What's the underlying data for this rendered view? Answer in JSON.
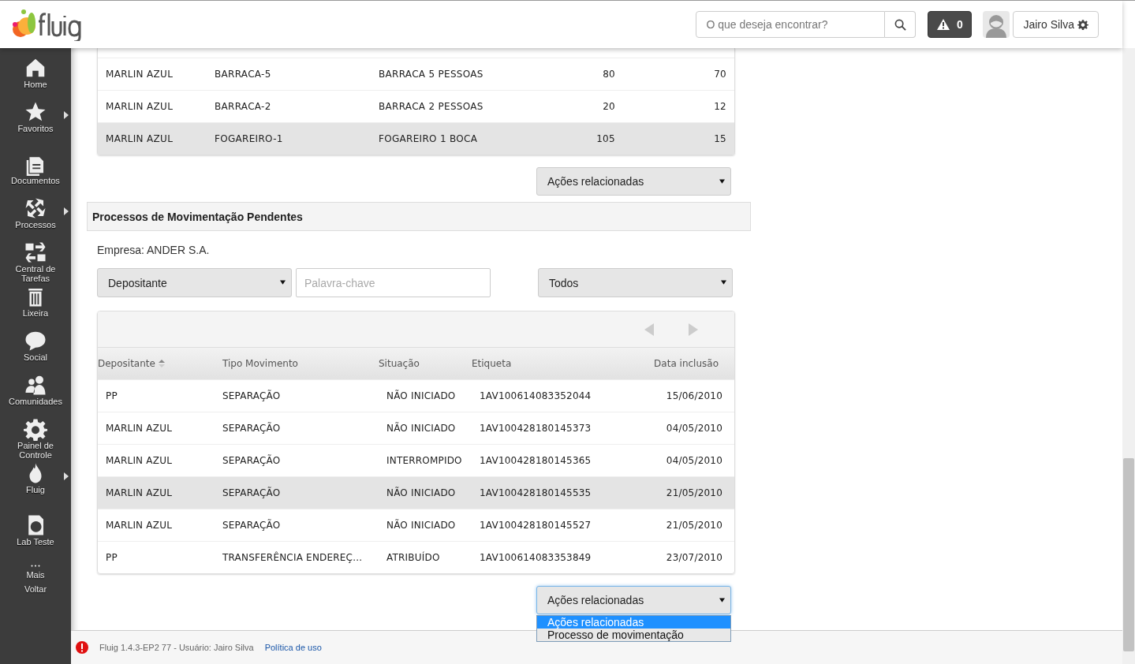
{
  "header": {
    "search": {
      "placeholder": "O que deseja encontrar?"
    },
    "alerts": {
      "count": "0"
    },
    "user": {
      "name": "Jairo Silva"
    }
  },
  "sidebar": {
    "items": [
      {
        "label": "Home",
        "has_submenu": false
      },
      {
        "label": "Favoritos",
        "has_submenu": true
      },
      {
        "label": "Documentos",
        "has_submenu": false
      },
      {
        "label": "Processos",
        "has_submenu": true
      },
      {
        "label": "Central de Tarefas",
        "has_submenu": false
      },
      {
        "label": "Lixeira",
        "has_submenu": false
      },
      {
        "label": "Social",
        "has_submenu": false
      },
      {
        "label": "Comunidades",
        "has_submenu": false
      },
      {
        "label": "Painel de Controle",
        "has_submenu": false
      },
      {
        "label": "Fluig",
        "has_submenu": true
      },
      {
        "label": "Lab Teste",
        "has_submenu": false
      },
      {
        "label": "Mais",
        "has_submenu": false
      },
      {
        "label": "Voltar",
        "has_submenu": false
      }
    ]
  },
  "stock_table": {
    "rows": [
      {
        "cells": [
          "MARLIN AZUL",
          "BARRACA-5",
          "BARRACA 5 PESSOAS",
          "80",
          "70"
        ],
        "highlighted": false
      },
      {
        "cells": [
          "MARLIN AZUL",
          "BARRACA-2",
          "BARRACA 2 PESSOAS",
          "20",
          "12"
        ],
        "highlighted": false
      },
      {
        "cells": [
          "MARLIN AZUL",
          "FOGAREIRO-1",
          "FOGAREIRO 1 BOCA",
          "105",
          "15"
        ],
        "highlighted": true
      }
    ]
  },
  "stock_actions": {
    "value": "Ações relacionadas"
  },
  "section": {
    "title": "Processos de Movimentação Pendentes"
  },
  "company": "Empresa: ANDER S.A.",
  "filters": {
    "field": "Depositante",
    "keyword_placeholder": "Palavra-chave",
    "status": "Todos"
  },
  "process_table": {
    "columns": [
      {
        "label": "Depositante",
        "sorted": true
      },
      {
        "label": "Tipo Movimento",
        "sorted": false
      },
      {
        "label": "Situação",
        "sorted": false
      },
      {
        "label": "Etiqueta",
        "sorted": false
      },
      {
        "label": "Data inclusão",
        "sorted": false
      }
    ],
    "rows": [
      {
        "cells": [
          "PP",
          "SEPARAÇÃO",
          "NÃO INICIADO",
          "1AV100614083352044",
          "15/06/2010"
        ],
        "highlighted": false
      },
      {
        "cells": [
          "MARLIN AZUL",
          "SEPARAÇÃO",
          "NÃO INICIADO",
          "1AV100428180145373",
          "04/05/2010"
        ],
        "highlighted": false
      },
      {
        "cells": [
          "MARLIN AZUL",
          "SEPARAÇÃO",
          "INTERROMPIDO",
          "1AV100428180145365",
          "04/05/2010"
        ],
        "highlighted": false
      },
      {
        "cells": [
          "MARLIN AZUL",
          "SEPARAÇÃO",
          "NÃO INICIADO",
          "1AV100428180145535",
          "21/05/2010"
        ],
        "highlighted": true
      },
      {
        "cells": [
          "MARLIN AZUL",
          "SEPARAÇÃO",
          "NÃO INICIADO",
          "1AV100428180145527",
          "21/05/2010"
        ],
        "highlighted": false
      },
      {
        "cells": [
          "PP",
          "TRANSFERÊNCIA ENDEREÇ...",
          "ATRIBUÍDO",
          "1AV100614083353849",
          "23/07/2010"
        ],
        "highlighted": false
      }
    ]
  },
  "process_actions": {
    "value": "Ações relacionadas",
    "open": true,
    "options": [
      {
        "label": "Ações relacionadas",
        "selected": true
      },
      {
        "label": "Processo de movimentação",
        "selected": false
      }
    ]
  },
  "footer": {
    "text": "Fluig 1.4.3-EP2 77 - Usuário: Jairo Silva",
    "link": "Política de uso"
  }
}
